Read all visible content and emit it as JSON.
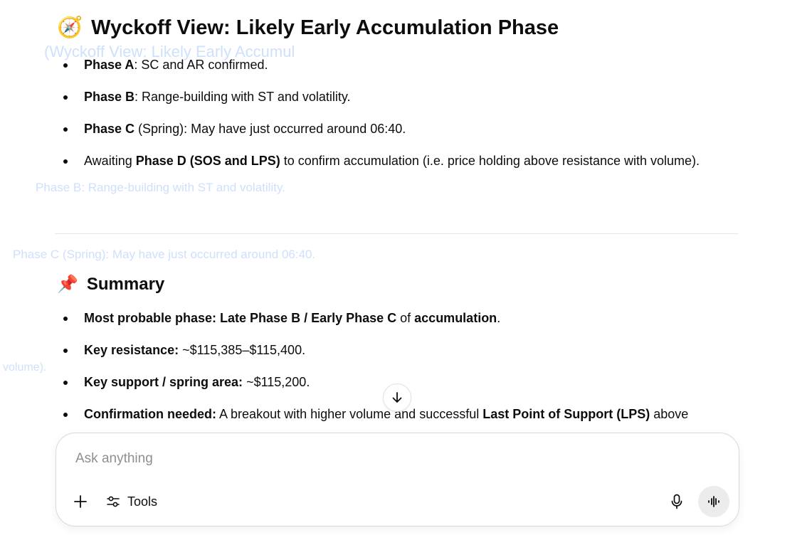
{
  "ghost_text": [
    "(Wyckoff View: Likely Early Accumul",
    "Phase B: Range-building with ST and volatility.",
    "Phase C (Spring): May have just occurred around 06:40.",
    "volume)."
  ],
  "wyckoff": {
    "emoji": "🧭",
    "title": "Wyckoff View: Likely Early Accumulation Phase",
    "items": [
      {
        "bold": "Phase A",
        "text": ": SC and AR confirmed."
      },
      {
        "bold": "Phase B",
        "text": ": Range-building with ST and volatility."
      },
      {
        "bold": "Phase C",
        "text": " (Spring): May have just occurred around 06:40."
      },
      {
        "pre": "Awaiting ",
        "bold": "Phase D (SOS and LPS)",
        "text": " to confirm accumulation (i.e. price holding above resistance with volume)."
      }
    ]
  },
  "summary": {
    "emoji": "📌",
    "title": "Summary",
    "items": [
      {
        "bold": "Most probable phase: Late Phase B / Early Phase C",
        "text": " of ",
        "bold2": "accumulation",
        "tail": "."
      },
      {
        "bold": "Key resistance:",
        "text": " ~$115,385–$115,400."
      },
      {
        "bold": "Key support / spring area:",
        "text": " ~$115,200."
      },
      {
        "bold": "Confirmation needed:",
        "text": " A breakout with higher volume and successful ",
        "bold2": "Last Point of Support (LPS)",
        "tail": " above"
      }
    ]
  },
  "composer": {
    "placeholder": "Ask anything",
    "tools_label": "Tools"
  },
  "icons": {
    "scroll": "arrow-down-icon",
    "plus": "plus-icon",
    "tools": "sliders-icon",
    "mic": "microphone-icon",
    "voice": "voice-waveform-icon"
  }
}
